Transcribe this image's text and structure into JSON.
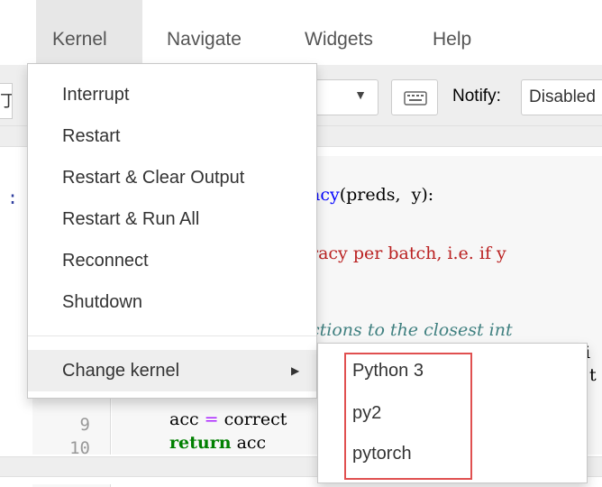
{
  "menubar": {
    "items": [
      "Kernel",
      "Navigate",
      "Widgets",
      "Help"
    ]
  },
  "toolbar": {
    "left_stub_char": "丁",
    "cell_type_caret": "▼",
    "notify_label": "Notify:",
    "notify_value": "Disabled"
  },
  "cell": {
    "prompt": ":",
    "code_fragments": {
      "line1_fn": "acy",
      "line1_rest": "(preds,  y):",
      "line3_str": "racy per batch, i.e. if y",
      "line5_comment": "ctions to the closest int",
      "line6_partial_a": "i",
      "line7_partial_b": "t",
      "line9_var": "acc",
      "line9_op": "=",
      "line9_rest": "correct",
      "line10_kw": "return",
      "line10_rest": "acc"
    },
    "line_numbers": [
      "9",
      "10"
    ]
  },
  "kernel_menu": {
    "items": [
      "Interrupt",
      "Restart",
      "Restart & Clear Output",
      "Restart & Run All",
      "Reconnect",
      "Shutdown"
    ],
    "change_kernel": "Change kernel",
    "submenu_caret": "▶"
  },
  "kernel_submenu": {
    "items": [
      "Python 3",
      "py2",
      "pytorch"
    ],
    "highlight_color": "#e05050"
  }
}
